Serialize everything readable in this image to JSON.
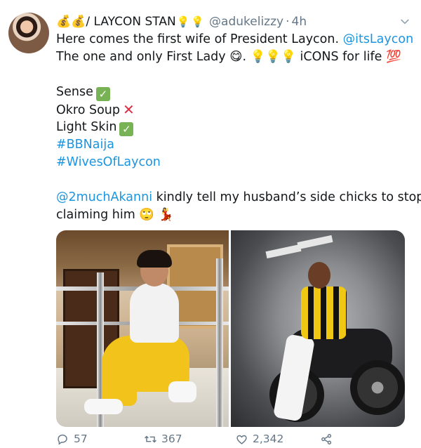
{
  "tweet": {
    "display_name": "💰💰/ LAYCON STAN",
    "name_emojis": [
      "💡",
      "💡"
    ],
    "handle": "@adukelizzy",
    "separator": "·",
    "time": "4h",
    "lines": {
      "l1_text": "Here comes the first wife of President Laycon. ",
      "l1_link": "@itsLaycon",
      "l2_text": "The one and only First Lady 😋.  💡💡💡 iCONS for life 💯",
      "l3_text": "Sense",
      "l4_text": "Okro Soup",
      "l5_text": "Light Skin",
      "l6_link": "#BBNaija",
      "l7_link": "#WivesOfLaycon",
      "l8_link": "@2muchAkanni",
      "l8_text": " kindly tell my husband’s side chicks to stop",
      "l9_text": "claiming him 🙄 💃"
    },
    "marks": {
      "check": "✓",
      "cross": "✕"
    },
    "actions": {
      "replies": "57",
      "retweets": "367",
      "likes": "2,342"
    }
  },
  "colors": {
    "link": "#1b95e0",
    "muted": "#657786",
    "text": "#14171a"
  },
  "icons": [
    "chevron-down-icon",
    "reply-icon",
    "retweet-icon",
    "like-icon",
    "share-icon"
  ]
}
